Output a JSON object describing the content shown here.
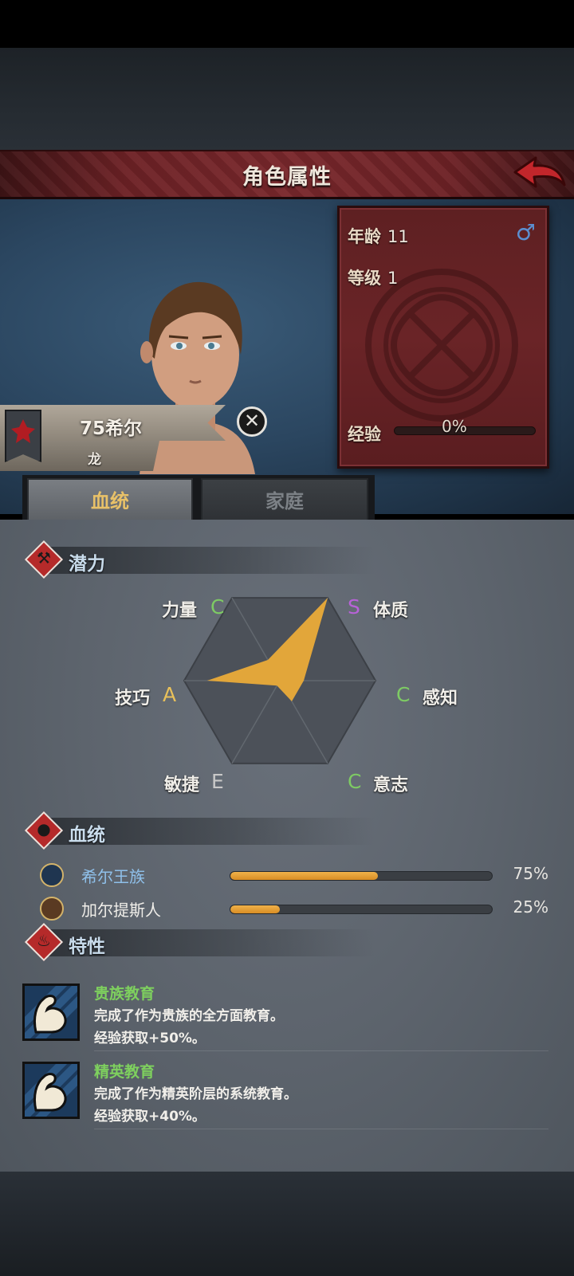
{
  "header": {
    "title": "角色属性"
  },
  "character": {
    "name": "75希尔",
    "subtitle": "龙",
    "stats": {
      "age_label": "年龄",
      "age_value": "11",
      "level_label": "等级",
      "level_value": "1",
      "exp_label": "经验",
      "exp_value": "0%"
    }
  },
  "tabs": {
    "bloodline": "血统",
    "family": "家庭"
  },
  "potential": {
    "section_label": "潜力",
    "attributes": [
      {
        "name": "力量",
        "grade": "C"
      },
      {
        "name": "体质",
        "grade": "S"
      },
      {
        "name": "感知",
        "grade": "C"
      },
      {
        "name": "意志",
        "grade": "C"
      },
      {
        "name": "敏捷",
        "grade": "E"
      },
      {
        "name": "技巧",
        "grade": "A"
      }
    ],
    "grade_colors": {
      "S": "#b862d8",
      "A": "#e8c05a",
      "C": "#7ecb64",
      "E": "#c8c8c8"
    },
    "fill_color": "#e2a63a"
  },
  "bloodline": {
    "section_label": "血统",
    "entries": [
      {
        "name": "希尔王族",
        "percent": "75%",
        "fraction": 0.75,
        "name_color": "#8fc0ea"
      },
      {
        "name": "加尔提斯人",
        "percent": "25%",
        "fraction": 0.25,
        "name_color": "#f0eee9"
      }
    ]
  },
  "traits": {
    "section_label": "特性",
    "items": [
      {
        "title": "贵族教育",
        "desc": "完成了作为贵族的全方面教育。",
        "effect": "经验获取+50%。"
      },
      {
        "title": "精英教育",
        "desc": "完成了作为精英阶层的系统教育。",
        "effect": "经验获取+40%。"
      }
    ]
  }
}
